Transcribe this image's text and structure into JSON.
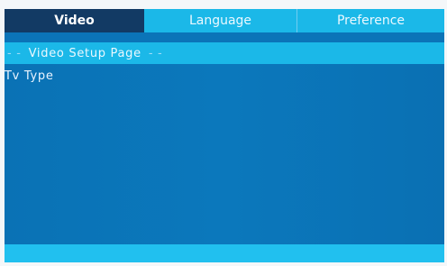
{
  "tabs": {
    "video": "Video",
    "language": "Language",
    "preference": "Preference"
  },
  "page": {
    "dash_left": "- -",
    "title": "Video Setup Page",
    "dash_right": "- -"
  },
  "items": {
    "tv_type": "Tv Type"
  },
  "colors": {
    "tab_bar": "#1bb8e8",
    "selected_tab": "#123a64",
    "panel": "#0b74b8",
    "footer": "#21c0ef"
  }
}
